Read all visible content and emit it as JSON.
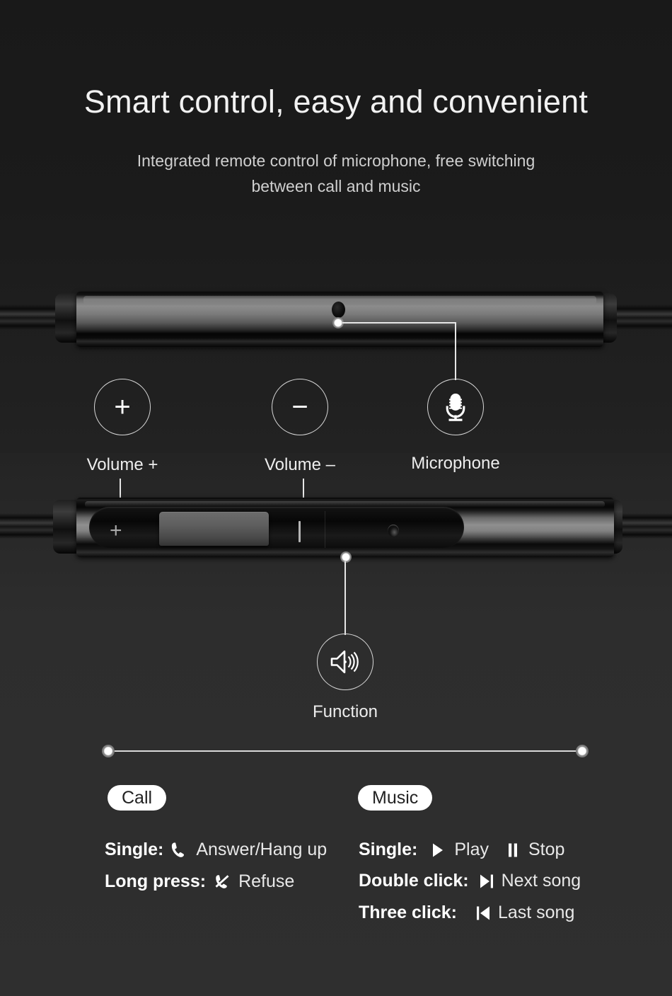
{
  "header": {
    "title": "Smart control, easy and convenient",
    "subtitle_line1": "Integrated remote control of microphone, free switching",
    "subtitle_line2": "between call and music"
  },
  "callouts": [
    {
      "id": "volume-up",
      "icon": "plus-icon",
      "symbol": "+",
      "label": "Volume +"
    },
    {
      "id": "volume-down",
      "icon": "minus-icon",
      "symbol": "−",
      "label": "Volume –"
    },
    {
      "id": "microphone",
      "icon": "microphone-icon",
      "symbol": "",
      "label": "Microphone"
    },
    {
      "id": "function",
      "icon": "speaker-icon",
      "symbol": "",
      "label": "Function"
    }
  ],
  "sections": {
    "call": {
      "badge": "Call",
      "rows": [
        {
          "key": "Single:",
          "icon": "phone-icon",
          "value": "Answer/Hang up"
        },
        {
          "key": "Long press:",
          "icon": "phone-decline-icon",
          "value": "Refuse"
        }
      ]
    },
    "music": {
      "badge": "Music",
      "rows": [
        {
          "key": "Single:",
          "icon": "play-icon",
          "value": "Play",
          "icon2": "pause-icon",
          "value2": "Stop"
        },
        {
          "key": "Double click:",
          "icon": "next-icon",
          "value": "Next song"
        },
        {
          "key": "Three click:",
          "icon": "previous-icon",
          "value": "Last song"
        }
      ]
    }
  },
  "colors": {
    "background_top": "#1a1a1a",
    "background_bottom": "#2e2e2e",
    "text_primary": "#ffffff",
    "text_secondary": "#cfcfcf",
    "accent_line": "#e6e6e6",
    "pill_background": "#ffffff",
    "pill_text": "#222222"
  }
}
